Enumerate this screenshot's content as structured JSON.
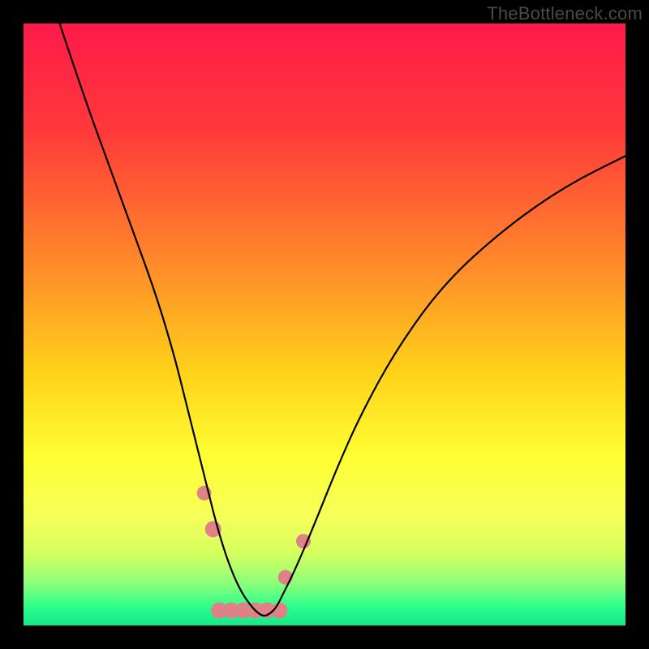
{
  "watermark": "TheBottleneck.com",
  "chart_data": {
    "type": "line",
    "title": "",
    "xlabel": "",
    "ylabel": "",
    "xlim": [
      0,
      100
    ],
    "ylim": [
      0,
      100
    ],
    "series": [
      {
        "name": "curve",
        "x": [
          6,
          10,
          14,
          18,
          22,
          25,
          27,
          29,
          30.5,
          32,
          33.5,
          35,
          36.5,
          38,
          39,
          40,
          41,
          42,
          43,
          45,
          48,
          52,
          56,
          62,
          70,
          80,
          90,
          100
        ],
        "y": [
          100,
          88,
          77,
          66,
          55,
          45,
          37,
          29,
          23,
          17,
          12,
          8,
          5,
          3,
          2,
          1.5,
          2,
          3,
          5,
          9,
          16,
          26,
          35,
          46,
          57,
          66,
          73,
          78
        ]
      }
    ],
    "gradient_stops": [
      {
        "offset": 0.0,
        "color": "#ff1a4a"
      },
      {
        "offset": 0.18,
        "color": "#ff3a3a"
      },
      {
        "offset": 0.4,
        "color": "#ff8a2a"
      },
      {
        "offset": 0.58,
        "color": "#ffd21a"
      },
      {
        "offset": 0.72,
        "color": "#ffff33"
      },
      {
        "offset": 0.82,
        "color": "#f6ff5a"
      },
      {
        "offset": 0.88,
        "color": "#d5ff5e"
      },
      {
        "offset": 0.93,
        "color": "#8cff7a"
      },
      {
        "offset": 0.97,
        "color": "#2aff8c"
      },
      {
        "offset": 1.0,
        "color": "#18e58a"
      }
    ],
    "markers": [
      {
        "x": 30.0,
        "y": 22,
        "r": 9
      },
      {
        "x": 31.5,
        "y": 16,
        "r": 10
      },
      {
        "x": 43.5,
        "y": 8,
        "r": 9
      },
      {
        "x": 46.5,
        "y": 14,
        "r": 9
      }
    ],
    "valley_band": {
      "x_positions": [
        32.5,
        34.5,
        36.5,
        38.5,
        40.5,
        42.5
      ],
      "y": 2.5,
      "r": 10
    },
    "marker_color": "#e08187",
    "curve_stroke": "#000000",
    "curve_width": 2.2
  }
}
